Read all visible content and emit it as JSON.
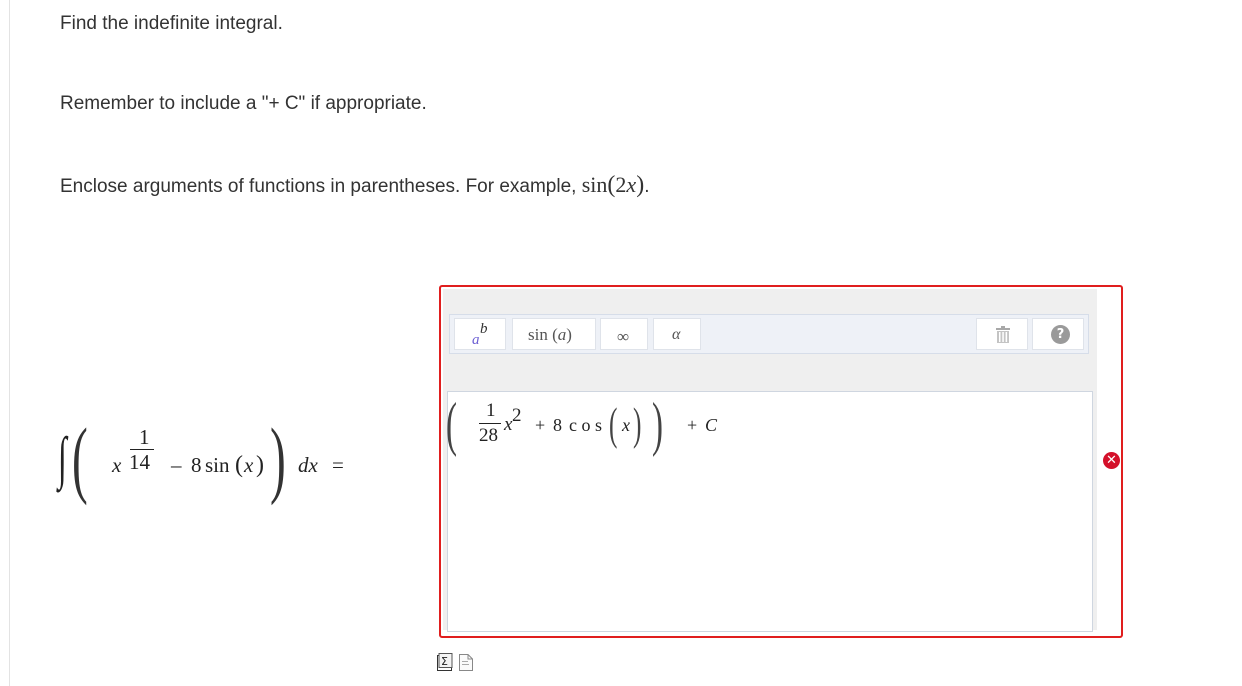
{
  "instructions": {
    "line1": "Find the indefinite integral.",
    "line2": "Remember to include a \"+ C\" if appropriate.",
    "line3_prefix": "Enclose arguments of functions in parentheses. For example,",
    "line3_fn": "sin",
    "line3_arg_coef": "2",
    "line3_arg_var": "x",
    "line3_suffix": "."
  },
  "problem": {
    "integral_sign": "∫",
    "open_paren": "(",
    "var_x": "x",
    "exp_num": "1",
    "exp_den": "14",
    "minus": "–",
    "coef": "8",
    "fn": "sin",
    "arg": "x",
    "close_paren": ")",
    "d": "dx",
    "equals": "="
  },
  "toolbar": {
    "superscript_base": "a",
    "superscript_exp": "b",
    "sin_label": "sin",
    "sin_arg": "a",
    "infinity": "∞",
    "alpha": "α",
    "help": "?"
  },
  "answer": {
    "frac_num": "1",
    "frac_den": "28",
    "var": "x",
    "power": "2",
    "plus1": "+",
    "coef": "8",
    "fn_letters": "c o s",
    "arg": "x",
    "plus2": "+",
    "constant": "C"
  },
  "status": {
    "error_mark": "✕"
  },
  "colors": {
    "error_border": "#e01e1e",
    "toolbar_bg": "#eef1f7",
    "error_icon": "#d4102a"
  }
}
